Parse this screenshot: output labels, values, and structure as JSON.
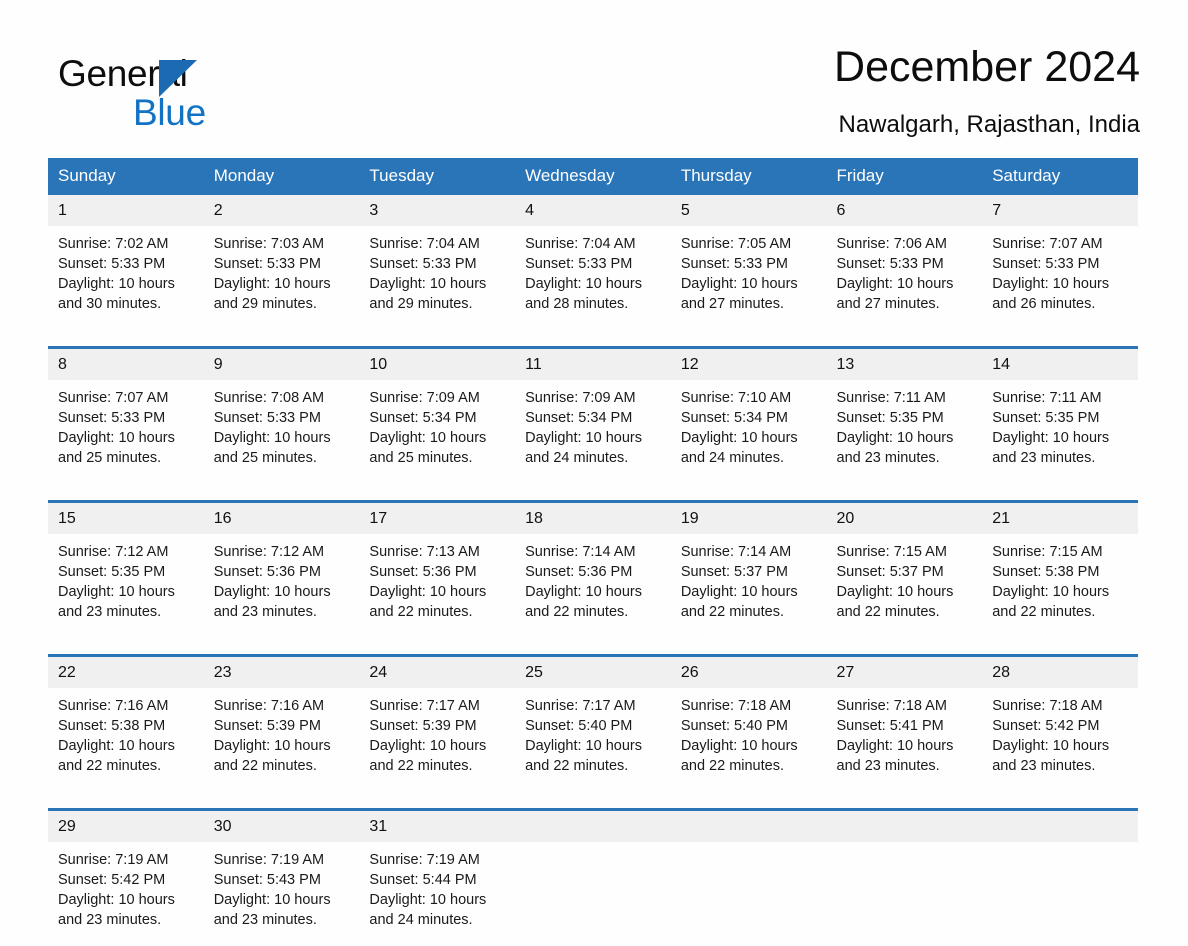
{
  "brand": {
    "name_part1": "General",
    "name_part2": "Blue",
    "logo_icon": "triangle-logo-icon",
    "accent_color": "#1273c4"
  },
  "header": {
    "title": "December 2024",
    "location": "Nawalgarh, Rajasthan, India"
  },
  "theme": {
    "header_blue": "#2a74b8",
    "daynum_band": "#f0f0f0",
    "page_bg": "#fefefe",
    "text": "#1a1a1a"
  },
  "weekdays": [
    "Sunday",
    "Monday",
    "Tuesday",
    "Wednesday",
    "Thursday",
    "Friday",
    "Saturday"
  ],
  "weeks": [
    {
      "days": [
        {
          "num": "1",
          "sunrise": "Sunrise: 7:02 AM",
          "sunset": "Sunset: 5:33 PM",
          "daylight1": "Daylight: 10 hours",
          "daylight2": "and 30 minutes."
        },
        {
          "num": "2",
          "sunrise": "Sunrise: 7:03 AM",
          "sunset": "Sunset: 5:33 PM",
          "daylight1": "Daylight: 10 hours",
          "daylight2": "and 29 minutes."
        },
        {
          "num": "3",
          "sunrise": "Sunrise: 7:04 AM",
          "sunset": "Sunset: 5:33 PM",
          "daylight1": "Daylight: 10 hours",
          "daylight2": "and 29 minutes."
        },
        {
          "num": "4",
          "sunrise": "Sunrise: 7:04 AM",
          "sunset": "Sunset: 5:33 PM",
          "daylight1": "Daylight: 10 hours",
          "daylight2": "and 28 minutes."
        },
        {
          "num": "5",
          "sunrise": "Sunrise: 7:05 AM",
          "sunset": "Sunset: 5:33 PM",
          "daylight1": "Daylight: 10 hours",
          "daylight2": "and 27 minutes."
        },
        {
          "num": "6",
          "sunrise": "Sunrise: 7:06 AM",
          "sunset": "Sunset: 5:33 PM",
          "daylight1": "Daylight: 10 hours",
          "daylight2": "and 27 minutes."
        },
        {
          "num": "7",
          "sunrise": "Sunrise: 7:07 AM",
          "sunset": "Sunset: 5:33 PM",
          "daylight1": "Daylight: 10 hours",
          "daylight2": "and 26 minutes."
        }
      ]
    },
    {
      "days": [
        {
          "num": "8",
          "sunrise": "Sunrise: 7:07 AM",
          "sunset": "Sunset: 5:33 PM",
          "daylight1": "Daylight: 10 hours",
          "daylight2": "and 25 minutes."
        },
        {
          "num": "9",
          "sunrise": "Sunrise: 7:08 AM",
          "sunset": "Sunset: 5:33 PM",
          "daylight1": "Daylight: 10 hours",
          "daylight2": "and 25 minutes."
        },
        {
          "num": "10",
          "sunrise": "Sunrise: 7:09 AM",
          "sunset": "Sunset: 5:34 PM",
          "daylight1": "Daylight: 10 hours",
          "daylight2": "and 25 minutes."
        },
        {
          "num": "11",
          "sunrise": "Sunrise: 7:09 AM",
          "sunset": "Sunset: 5:34 PM",
          "daylight1": "Daylight: 10 hours",
          "daylight2": "and 24 minutes."
        },
        {
          "num": "12",
          "sunrise": "Sunrise: 7:10 AM",
          "sunset": "Sunset: 5:34 PM",
          "daylight1": "Daylight: 10 hours",
          "daylight2": "and 24 minutes."
        },
        {
          "num": "13",
          "sunrise": "Sunrise: 7:11 AM",
          "sunset": "Sunset: 5:35 PM",
          "daylight1": "Daylight: 10 hours",
          "daylight2": "and 23 minutes."
        },
        {
          "num": "14",
          "sunrise": "Sunrise: 7:11 AM",
          "sunset": "Sunset: 5:35 PM",
          "daylight1": "Daylight: 10 hours",
          "daylight2": "and 23 minutes."
        }
      ]
    },
    {
      "days": [
        {
          "num": "15",
          "sunrise": "Sunrise: 7:12 AM",
          "sunset": "Sunset: 5:35 PM",
          "daylight1": "Daylight: 10 hours",
          "daylight2": "and 23 minutes."
        },
        {
          "num": "16",
          "sunrise": "Sunrise: 7:12 AM",
          "sunset": "Sunset: 5:36 PM",
          "daylight1": "Daylight: 10 hours",
          "daylight2": "and 23 minutes."
        },
        {
          "num": "17",
          "sunrise": "Sunrise: 7:13 AM",
          "sunset": "Sunset: 5:36 PM",
          "daylight1": "Daylight: 10 hours",
          "daylight2": "and 22 minutes."
        },
        {
          "num": "18",
          "sunrise": "Sunrise: 7:14 AM",
          "sunset": "Sunset: 5:36 PM",
          "daylight1": "Daylight: 10 hours",
          "daylight2": "and 22 minutes."
        },
        {
          "num": "19",
          "sunrise": "Sunrise: 7:14 AM",
          "sunset": "Sunset: 5:37 PM",
          "daylight1": "Daylight: 10 hours",
          "daylight2": "and 22 minutes."
        },
        {
          "num": "20",
          "sunrise": "Sunrise: 7:15 AM",
          "sunset": "Sunset: 5:37 PM",
          "daylight1": "Daylight: 10 hours",
          "daylight2": "and 22 minutes."
        },
        {
          "num": "21",
          "sunrise": "Sunrise: 7:15 AM",
          "sunset": "Sunset: 5:38 PM",
          "daylight1": "Daylight: 10 hours",
          "daylight2": "and 22 minutes."
        }
      ]
    },
    {
      "days": [
        {
          "num": "22",
          "sunrise": "Sunrise: 7:16 AM",
          "sunset": "Sunset: 5:38 PM",
          "daylight1": "Daylight: 10 hours",
          "daylight2": "and 22 minutes."
        },
        {
          "num": "23",
          "sunrise": "Sunrise: 7:16 AM",
          "sunset": "Sunset: 5:39 PM",
          "daylight1": "Daylight: 10 hours",
          "daylight2": "and 22 minutes."
        },
        {
          "num": "24",
          "sunrise": "Sunrise: 7:17 AM",
          "sunset": "Sunset: 5:39 PM",
          "daylight1": "Daylight: 10 hours",
          "daylight2": "and 22 minutes."
        },
        {
          "num": "25",
          "sunrise": "Sunrise: 7:17 AM",
          "sunset": "Sunset: 5:40 PM",
          "daylight1": "Daylight: 10 hours",
          "daylight2": "and 22 minutes."
        },
        {
          "num": "26",
          "sunrise": "Sunrise: 7:18 AM",
          "sunset": "Sunset: 5:40 PM",
          "daylight1": "Daylight: 10 hours",
          "daylight2": "and 22 minutes."
        },
        {
          "num": "27",
          "sunrise": "Sunrise: 7:18 AM",
          "sunset": "Sunset: 5:41 PM",
          "daylight1": "Daylight: 10 hours",
          "daylight2": "and 23 minutes."
        },
        {
          "num": "28",
          "sunrise": "Sunrise: 7:18 AM",
          "sunset": "Sunset: 5:42 PM",
          "daylight1": "Daylight: 10 hours",
          "daylight2": "and 23 minutes."
        }
      ]
    },
    {
      "days": [
        {
          "num": "29",
          "sunrise": "Sunrise: 7:19 AM",
          "sunset": "Sunset: 5:42 PM",
          "daylight1": "Daylight: 10 hours",
          "daylight2": "and 23 minutes."
        },
        {
          "num": "30",
          "sunrise": "Sunrise: 7:19 AM",
          "sunset": "Sunset: 5:43 PM",
          "daylight1": "Daylight: 10 hours",
          "daylight2": "and 23 minutes."
        },
        {
          "num": "31",
          "sunrise": "Sunrise: 7:19 AM",
          "sunset": "Sunset: 5:44 PM",
          "daylight1": "Daylight: 10 hours",
          "daylight2": "and 24 minutes."
        },
        {
          "num": "",
          "sunrise": "",
          "sunset": "",
          "daylight1": "",
          "daylight2": ""
        },
        {
          "num": "",
          "sunrise": "",
          "sunset": "",
          "daylight1": "",
          "daylight2": ""
        },
        {
          "num": "",
          "sunrise": "",
          "sunset": "",
          "daylight1": "",
          "daylight2": ""
        },
        {
          "num": "",
          "sunrise": "",
          "sunset": "",
          "daylight1": "",
          "daylight2": ""
        }
      ]
    }
  ]
}
